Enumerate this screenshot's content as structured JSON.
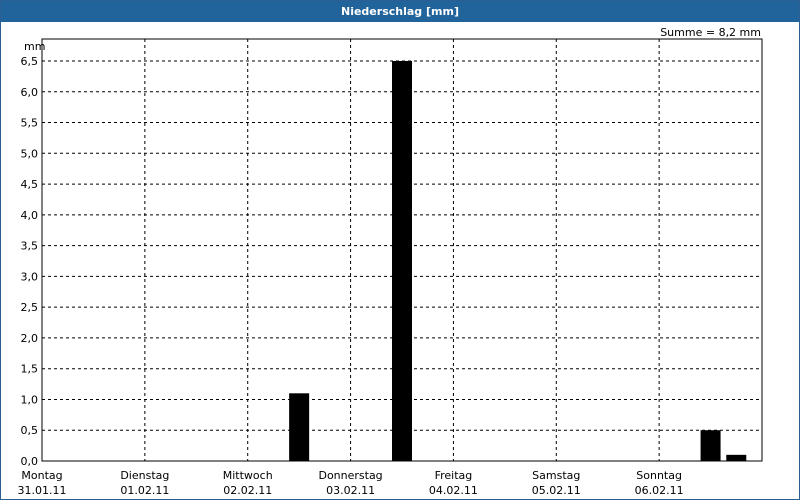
{
  "window": {
    "title": "Niederschlag [mm]"
  },
  "chart_data": {
    "type": "bar",
    "title": "Niederschlag [mm]",
    "ylabel": "mm",
    "summary": "Summe = 8,2 mm",
    "ylim": [
      0,
      6.5
    ],
    "yticks": [
      "0,0",
      "0,5",
      "1,0",
      "1,5",
      "2,0",
      "2,5",
      "3,0",
      "3,5",
      "4,0",
      "4,5",
      "5,0",
      "5,5",
      "6,0",
      "6,5"
    ],
    "days": [
      {
        "name": "Montag",
        "date": "31.01.11"
      },
      {
        "name": "Dienstag",
        "date": "01.02.11"
      },
      {
        "name": "Mittwoch",
        "date": "02.02.11"
      },
      {
        "name": "Donnerstag",
        "date": "03.02.11"
      },
      {
        "name": "Freitag",
        "date": "04.02.11"
      },
      {
        "name": "Samstag",
        "date": "05.02.11"
      },
      {
        "name": "Sonntag",
        "date": "06.02.11"
      }
    ],
    "bars": [
      {
        "x": "02.02.11 12:00",
        "value": 1.1
      },
      {
        "x": "03.02.11 12:00",
        "value": 6.5
      },
      {
        "x": "06.02.11 12:00",
        "value": 0.5
      },
      {
        "x": "06.02.11 18:00",
        "value": 0.1
      }
    ],
    "grid": true,
    "bar_color": "#000000"
  }
}
